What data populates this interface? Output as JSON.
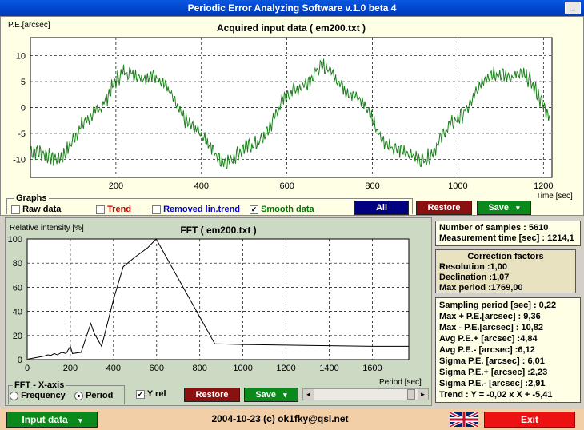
{
  "window": {
    "title": "Periodic Error Analyzing Software v.1.0 beta 4",
    "minimize_label": "_"
  },
  "top_chart": {
    "title": "Acquired input data ( em200.txt )",
    "ylabel": "P.E.[arcsec]",
    "xlabel": "Time [sec]",
    "x_ticks": [
      "200",
      "400",
      "600",
      "800",
      "1000",
      "1200"
    ],
    "y_ticks": [
      "10",
      "5",
      "0",
      "-5",
      "-10"
    ]
  },
  "graphs": {
    "legend": "Graphs",
    "raw_label": "Raw data",
    "raw_checked": false,
    "trend_label": "Trend",
    "trend_checked": false,
    "removed_label": "Removed lin.trend",
    "removed_checked": false,
    "smooth_label": "Smooth data",
    "smooth_checked": true,
    "checkmark": "✓",
    "all_button": "All",
    "restore_button": "Restore",
    "save_button": "Save",
    "colors": {
      "raw": "#000000",
      "trend": "#cc0000",
      "removed": "#0000cc",
      "smooth": "#007700",
      "all_btn": "#000080",
      "restore_btn": "#8b1010",
      "save_btn": "#0a8a1a"
    }
  },
  "fft_chart": {
    "title": "FFT ( em200.txt )",
    "ylabel": "Relative intensity [%]",
    "xlabel": "Period [sec]",
    "x_ticks": [
      "0",
      "200",
      "400",
      "600",
      "800",
      "1000",
      "1200",
      "1400",
      "1600"
    ],
    "y_ticks": [
      "100",
      "80",
      "60",
      "40",
      "20",
      "0"
    ]
  },
  "fft_controls": {
    "xaxis_legend": "FFT - X-axis",
    "frequency_label": "Frequency",
    "frequency_selected": false,
    "period_label": "Period",
    "period_selected": true,
    "yrel_label": "Y rel",
    "yrel_checked": true,
    "restore_button": "Restore",
    "save_button": "Save",
    "scroll_left": "◄",
    "scroll_right": "►"
  },
  "stats": {
    "samples": "Number of samples : 5610",
    "meas_time": "Measurement time [sec] : 1214,1",
    "correction_title": "Correction factors",
    "resolution": "Resolution :1,00",
    "declination": "Declination :1,07",
    "max_period": "Max period :1769,00",
    "sampling": "Sampling period [sec] : 0,22",
    "max_plus": "Max + P.E.[arcsec] : 9,36",
    "max_minus": "Max - P.E.[arcsec] : 10,82",
    "avg_plus": "Avg P.E.+ [arcsec] :4,84",
    "avg_minus": "Avg P.E.- [arcsec] :6,12",
    "sigma": "Sigma P.E. [arcsec] : 6,01",
    "sigma_plus": "Sigma P.E.+ [arcsec] :2,23",
    "sigma_minus": "Sigma P.E.- [arcsec] :2,91",
    "trend": "Trend : Y = -0,02 x X + -5,41"
  },
  "bottom": {
    "input_button": "Input data",
    "footer_text": "2004-10-23 (c) ok1fky@qsl.net",
    "exit_button": "Exit",
    "dropdown_arrow": "▾",
    "flag_icon": "uk-flag-icon"
  }
}
